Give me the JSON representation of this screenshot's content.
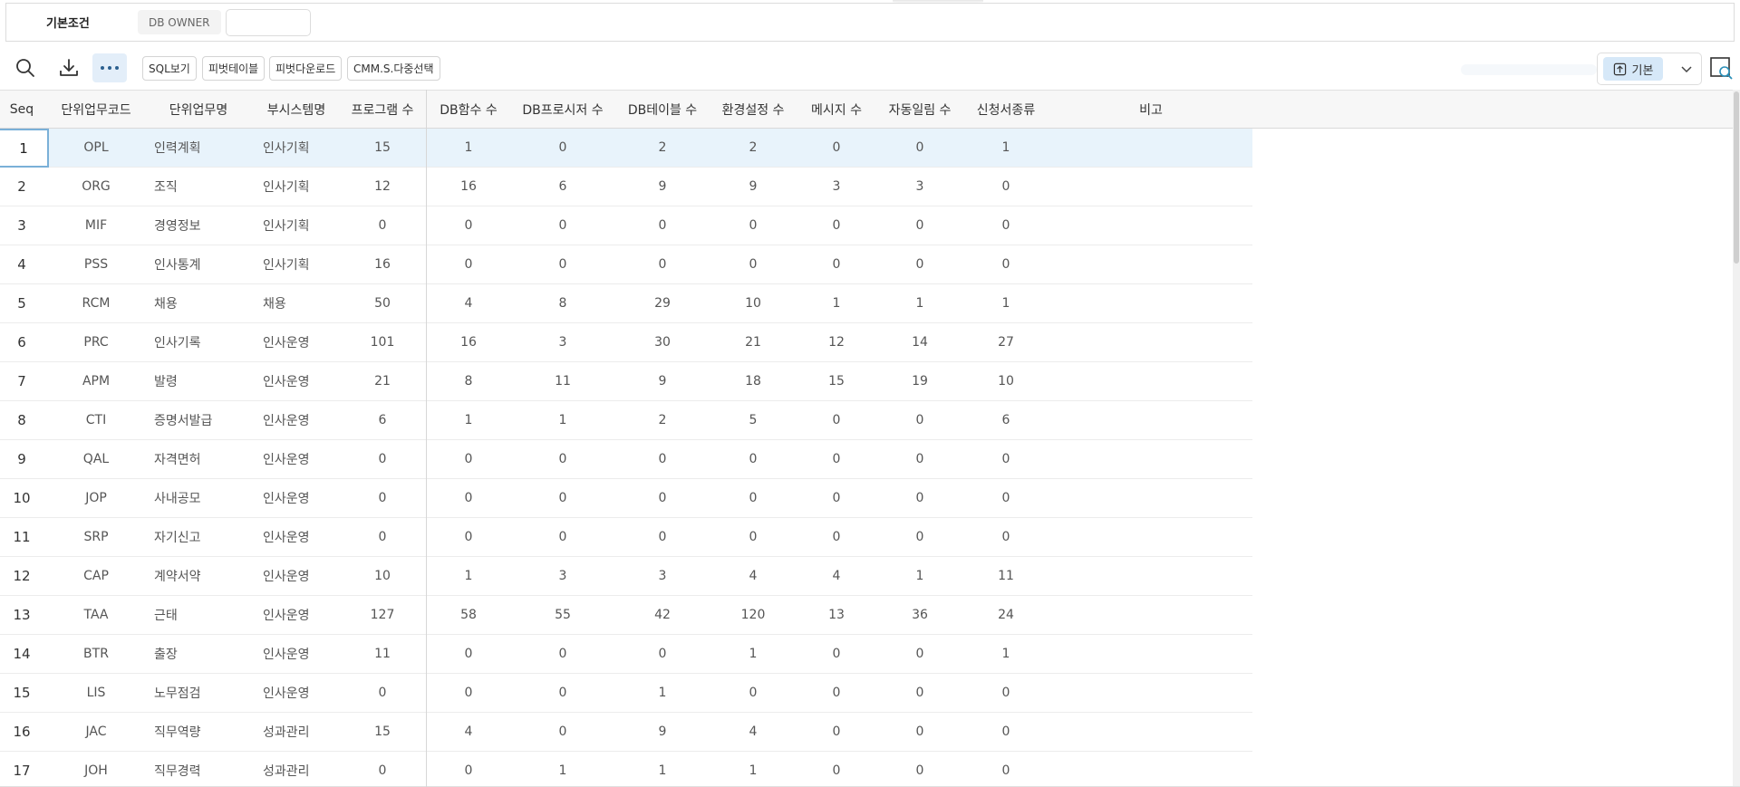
{
  "condition": {
    "title": "기본조건",
    "owner_label": "DB OWNER",
    "owner_value": ""
  },
  "toolbar": {
    "icons": [
      "search-icon",
      "download-icon",
      "more-icon"
    ],
    "buttons": [
      "SQL보기",
      "피벗테이블",
      "피벗다운로드",
      "CMM.S.다중선택"
    ],
    "layout_label": "기본"
  },
  "grid": {
    "columns": [
      "Seq",
      "단위업무코드",
      "단위업무명",
      "부시스템명",
      "프로그램 수",
      "DB함수 수",
      "DB프로시저 수",
      "DB테이블 수",
      "환경설정 수",
      "메시지 수",
      "자동일림 수",
      "신청서종류",
      "비고"
    ],
    "rows": [
      [
        "1",
        "OPL",
        "인력계획",
        "인사기획",
        "15",
        "1",
        "0",
        "2",
        "2",
        "0",
        "0",
        "1",
        ""
      ],
      [
        "2",
        "ORG",
        "조직",
        "인사기획",
        "12",
        "16",
        "6",
        "9",
        "9",
        "3",
        "3",
        "0",
        ""
      ],
      [
        "3",
        "MIF",
        "경영정보",
        "인사기획",
        "0",
        "0",
        "0",
        "0",
        "0",
        "0",
        "0",
        "0",
        ""
      ],
      [
        "4",
        "PSS",
        "인사통계",
        "인사기획",
        "16",
        "0",
        "0",
        "0",
        "0",
        "0",
        "0",
        "0",
        ""
      ],
      [
        "5",
        "RCM",
        "채용",
        "채용",
        "50",
        "4",
        "8",
        "29",
        "10",
        "1",
        "1",
        "1",
        ""
      ],
      [
        "6",
        "PRC",
        "인사기록",
        "인사운영",
        "101",
        "16",
        "3",
        "30",
        "21",
        "12",
        "14",
        "27",
        ""
      ],
      [
        "7",
        "APM",
        "발령",
        "인사운영",
        "21",
        "8",
        "11",
        "9",
        "18",
        "15",
        "19",
        "10",
        ""
      ],
      [
        "8",
        "CTI",
        "증명서발급",
        "인사운영",
        "6",
        "1",
        "1",
        "2",
        "5",
        "0",
        "0",
        "6",
        ""
      ],
      [
        "9",
        "QAL",
        "자격면허",
        "인사운영",
        "0",
        "0",
        "0",
        "0",
        "0",
        "0",
        "0",
        "0",
        ""
      ],
      [
        "10",
        "JOP",
        "사내공모",
        "인사운영",
        "0",
        "0",
        "0",
        "0",
        "0",
        "0",
        "0",
        "0",
        ""
      ],
      [
        "11",
        "SRP",
        "자기신고",
        "인사운영",
        "0",
        "0",
        "0",
        "0",
        "0",
        "0",
        "0",
        "0",
        ""
      ],
      [
        "12",
        "CAP",
        "계약서약",
        "인사운영",
        "10",
        "1",
        "3",
        "3",
        "4",
        "4",
        "1",
        "11",
        ""
      ],
      [
        "13",
        "TAA",
        "근태",
        "인사운영",
        "127",
        "58",
        "55",
        "42",
        "120",
        "13",
        "36",
        "24",
        ""
      ],
      [
        "14",
        "BTR",
        "출장",
        "인사운영",
        "11",
        "0",
        "0",
        "0",
        "1",
        "0",
        "0",
        "1",
        ""
      ],
      [
        "15",
        "LIS",
        "노무점검",
        "인사운영",
        "0",
        "0",
        "0",
        "1",
        "0",
        "0",
        "0",
        "0",
        ""
      ],
      [
        "16",
        "JAC",
        "직무역량",
        "성과관리",
        "15",
        "4",
        "0",
        "9",
        "4",
        "0",
        "0",
        "0",
        ""
      ],
      [
        "17",
        "JOH",
        "직무경력",
        "성과관리",
        "0",
        "0",
        "1",
        "1",
        "1",
        "0",
        "0",
        "0",
        ""
      ]
    ],
    "selected_row": 1
  }
}
